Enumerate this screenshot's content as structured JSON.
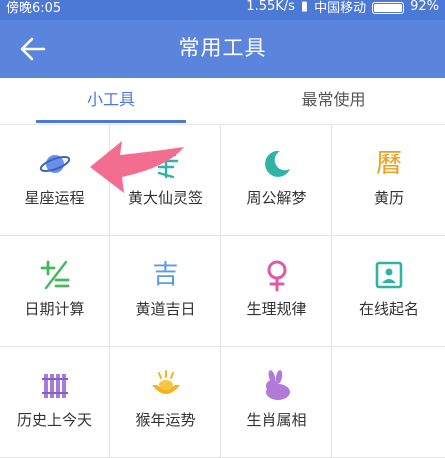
{
  "status_bar": {
    "time": "傍晚6:05",
    "speed": "1.55K/s",
    "carrier": "中国移动",
    "battery": "92%"
  },
  "app_bar": {
    "title": "常用工具",
    "back_icon": "arrow-left-icon"
  },
  "tabs": [
    {
      "label": "小工具",
      "active": true
    },
    {
      "label": "最常使用",
      "active": false
    }
  ],
  "tools": [
    {
      "label": "星座运程",
      "icon": "planet-icon"
    },
    {
      "label": "黄大仙灵签",
      "icon": "fortune-slip-icon"
    },
    {
      "label": "周公解梦",
      "icon": "moon-icon"
    },
    {
      "label": "黄历",
      "icon": "almanac-icon",
      "glyph": "曆"
    },
    {
      "label": "日期计算",
      "icon": "calculator-icon"
    },
    {
      "label": "黄道吉日",
      "icon": "auspicious-day-icon",
      "glyph": "吉"
    },
    {
      "label": "生理规律",
      "icon": "female-symbol-icon"
    },
    {
      "label": "在线起名",
      "icon": "name-card-icon"
    },
    {
      "label": "历史上今天",
      "icon": "history-icon"
    },
    {
      "label": "猴年运势",
      "icon": "gold-ingot-icon"
    },
    {
      "label": "生肖属相",
      "icon": "rabbit-icon"
    }
  ],
  "colors": {
    "primary": "#5b84dc",
    "status_bar": "#4c79d6",
    "tab_active": "#4c79d6",
    "arrow": "#f26d8f"
  }
}
